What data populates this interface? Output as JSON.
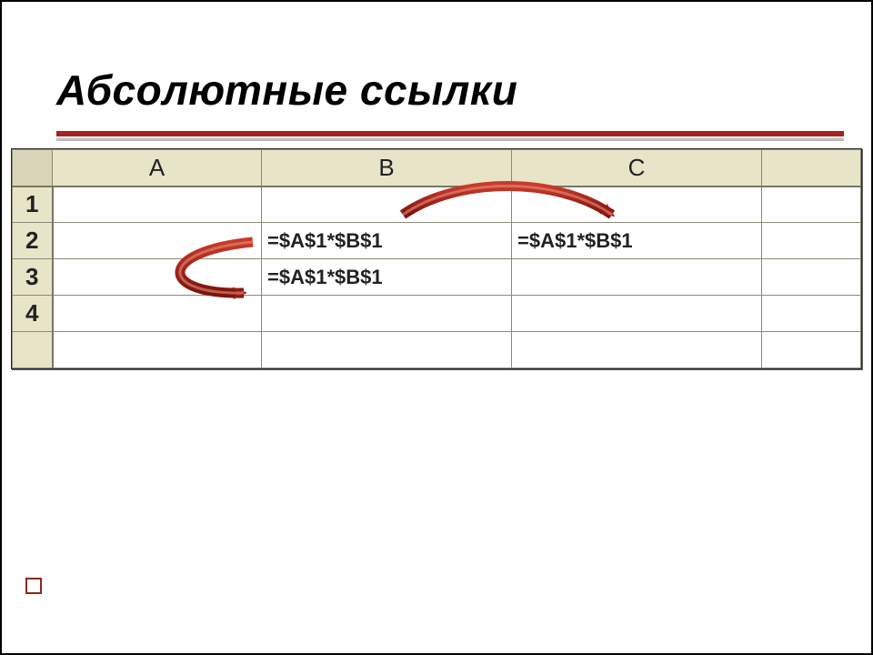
{
  "title": "Абсолютные ссылки",
  "columns": {
    "a": "A",
    "b": "B",
    "c": "C"
  },
  "rows": {
    "r1": "1",
    "r2": "2",
    "r3": "3",
    "r4": "4"
  },
  "cells": {
    "b2": "=$A$1*$B$1",
    "c2": "=$A$1*$B$1",
    "b3": "=$A$1*$B$1"
  },
  "arrow_color": "#9e1b12"
}
